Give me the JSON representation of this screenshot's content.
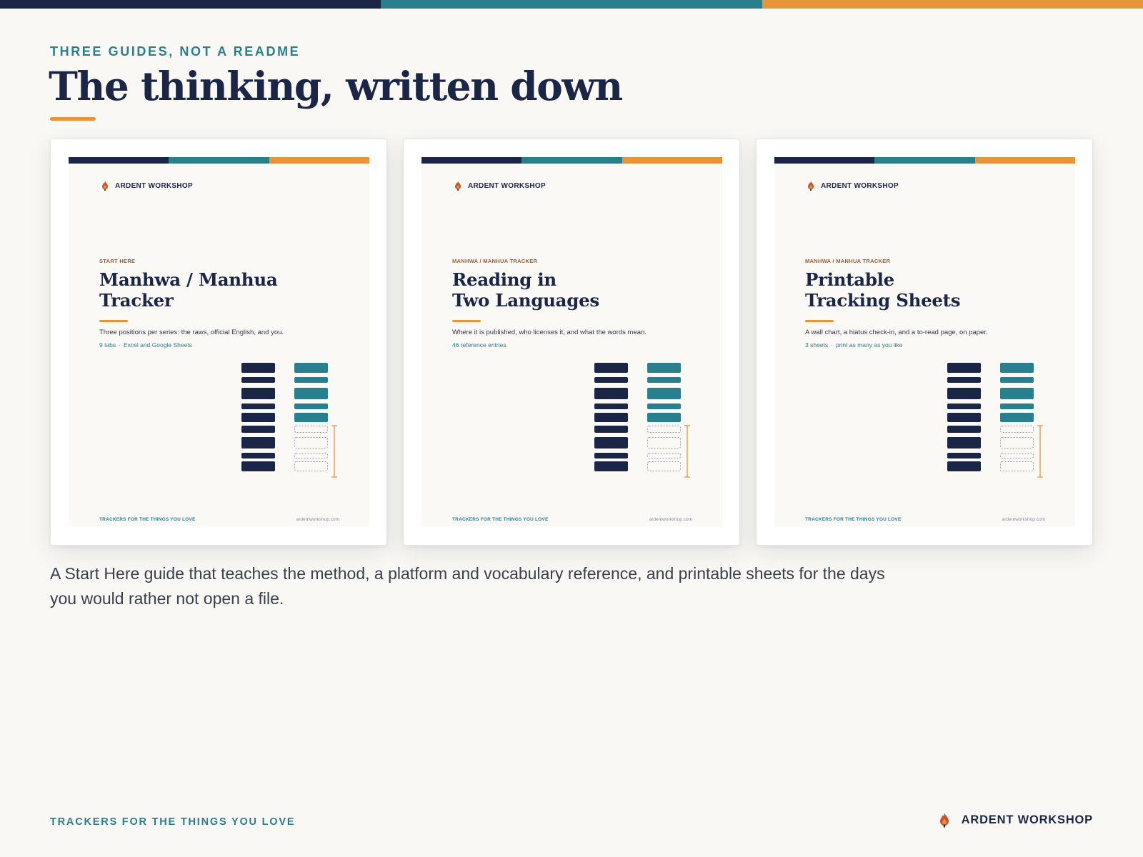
{
  "colors": {
    "navy": "#1b2545",
    "teal": "#2a7f8f",
    "orange": "#e8943a"
  },
  "header": {
    "eyebrow": "THREE GUIDES, NOT A README",
    "title": "The thinking, written down"
  },
  "cards": [
    {
      "brand": "ARDENT WORKSHOP",
      "eyebrow": "START HERE",
      "title_lines": [
        "Manhwa / Manhua",
        "Tracker"
      ],
      "description": "Three positions per series: the raws, official English, and you.",
      "meta": [
        "9 tabs",
        "Excel and Google Sheets"
      ],
      "footer_left": "TRACKERS FOR THE THINGS YOU LOVE",
      "footer_right": "ardentworkshop.com"
    },
    {
      "brand": "ARDENT WORKSHOP",
      "eyebrow": "MANHWA / MANHUA TRACKER",
      "title_lines": [
        "Reading in",
        "Two Languages"
      ],
      "description": "Where it is published, who licenses it, and what the words mean.",
      "meta": [
        "46 reference entries"
      ],
      "footer_left": "TRACKERS FOR THE THINGS YOU LOVE",
      "footer_right": "ardentworkshop.com"
    },
    {
      "brand": "ARDENT WORKSHOP",
      "eyebrow": "MANHWA / MANHUA TRACKER",
      "title_lines": [
        "Printable",
        "Tracking Sheets"
      ],
      "description": "A wall chart, a hiatus check-in, and a to-read page, on paper.",
      "meta": [
        "3 sheets",
        "print as many as you like"
      ],
      "footer_left": "TRACKERS FOR THE THINGS YOU LOVE",
      "footer_right": "ardentworkshop.com"
    }
  ],
  "caption": "A Start Here guide that teaches the method, a platform and vocabulary reference, and printable sheets for the days you would rather not open a file.",
  "footer": {
    "tagline": "TRACKERS FOR THE THINGS YOU LOVE",
    "brand": "ARDENT WORKSHOP"
  }
}
